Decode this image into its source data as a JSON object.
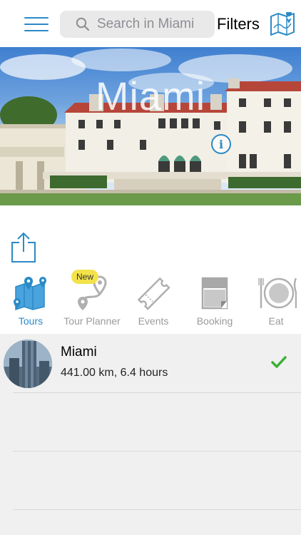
{
  "search": {
    "placeholder": "Search in Miami"
  },
  "header": {
    "filters_label": "Filters"
  },
  "hero": {
    "title": "Miami",
    "info_label": "i"
  },
  "categories": [
    {
      "label": "Tours",
      "icon": "map-pins-icon",
      "active": true
    },
    {
      "label": "Tour Planner",
      "icon": "route-planner-icon",
      "badge": "New"
    },
    {
      "label": "Events",
      "icon": "ticket-icon"
    },
    {
      "label": "Booking",
      "icon": "booking-icon"
    },
    {
      "label": "Eat",
      "icon": "plate-cutlery-icon"
    }
  ],
  "tours": [
    {
      "title": "Miami",
      "subtitle": "441.00 km, 6.4 hours",
      "selected": true
    }
  ],
  "colors": {
    "accent": "#2a8ac7",
    "check": "#3cb035",
    "badge": "#f3e24a",
    "list_bg": "#f0f0f0"
  }
}
